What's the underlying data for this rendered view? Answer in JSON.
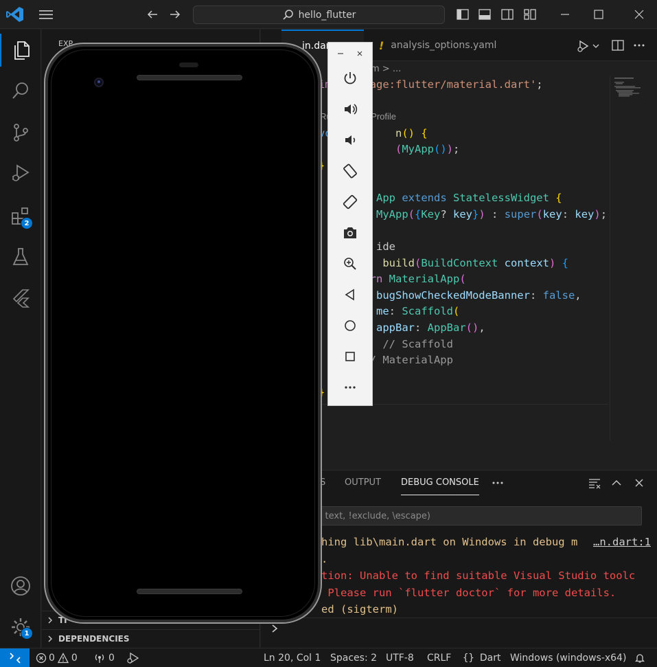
{
  "titlebar": {
    "search_text": "hello_flutter"
  },
  "activity": {
    "extensions_badge": "2",
    "settings_badge": "1"
  },
  "sidebar": {
    "sections": [
      "EXPLORER",
      "TIMELINE",
      "DEPENDENCIES"
    ],
    "partial_header": "EXP",
    "timeline_partial": "TI"
  },
  "editor": {
    "tabs": [
      {
        "label": "main.dart",
        "visible_text": "in.dar",
        "active": true
      },
      {
        "label": "analysis_options.yaml",
        "active": false
      }
    ],
    "breadcrumb": "m  >  ...",
    "codelens": "Ru           g | Profile",
    "lines": [
      {
        "segs": [
          [
            "im",
            "#c586c0"
          ],
          [
            " 'package:flutter/material.dart'",
            "#ce9178"
          ],
          [
            ";",
            "#cccccc"
          ]
        ]
      },
      {
        "segs": []
      },
      {
        "lens": "Ru           g | Profile"
      },
      {
        "segs": [
          [
            "vo",
            "#569cd6"
          ],
          [
            "          ",
            "#ccc"
          ],
          [
            "n",
            "#dcdcaa"
          ],
          [
            "() {",
            "#ffd700"
          ]
        ]
      },
      {
        "segs": [
          [
            "            ",
            "#ccc"
          ],
          [
            "(",
            "#da70d6"
          ],
          [
            "MyApp",
            "#4ec9b0"
          ],
          [
            "()",
            "#179fff"
          ],
          [
            ")",
            "#da70d6"
          ],
          [
            ";",
            "#cccccc"
          ]
        ]
      },
      {
        "segs": [
          [
            "}",
            "#ffd700"
          ]
        ]
      },
      {
        "segs": []
      },
      {
        "segs": [
          [
            "         App ",
            "#4ec9b0"
          ],
          [
            "extends ",
            "#569cd6"
          ],
          [
            "StatelessWidget ",
            "#4ec9b0"
          ],
          [
            "{",
            "#ffd700"
          ]
        ]
      },
      {
        "segs": [
          [
            "         MyApp",
            "#4ec9b0"
          ],
          [
            "(",
            "#da70d6"
          ],
          [
            "{",
            "#179fff"
          ],
          [
            "Key",
            "#4ec9b0"
          ],
          [
            "? ",
            "#cccccc"
          ],
          [
            "key",
            "#9cdcfe"
          ],
          [
            "}",
            "#179fff"
          ],
          [
            ")",
            "#da70d6"
          ],
          [
            " : ",
            "#cccccc"
          ],
          [
            "super",
            "#569cd6"
          ],
          [
            "(",
            "#da70d6"
          ],
          [
            "key",
            "#9cdcfe"
          ],
          [
            ": ",
            "#cccccc"
          ],
          [
            "key",
            "#9cdcfe"
          ],
          [
            ")",
            "#da70d6"
          ],
          [
            ";",
            "#cccccc"
          ]
        ]
      },
      {
        "segs": []
      },
      {
        "segs": [
          [
            "         ide",
            "#cccccc"
          ]
        ]
      },
      {
        "segs": [
          [
            "          ",
            "#ccc"
          ],
          [
            "build",
            "#dcdcaa"
          ],
          [
            "(",
            "#da70d6"
          ],
          [
            "BuildContext ",
            "#4ec9b0"
          ],
          [
            "context",
            "#9cdcfe"
          ],
          [
            ") ",
            "#da70d6"
          ],
          [
            "{",
            "#179fff"
          ]
        ]
      },
      {
        "segs": [
          [
            "        rn ",
            "#c586c0"
          ],
          [
            "MaterialApp",
            "#4ec9b0"
          ],
          [
            "(",
            "#da70d6"
          ]
        ]
      },
      {
        "segs": [
          [
            "         bugShowCheckedModeBanner",
            "#9cdcfe"
          ],
          [
            ": ",
            "#cccccc"
          ],
          [
            "false",
            "#569cd6"
          ],
          [
            ",",
            "#cccccc"
          ]
        ]
      },
      {
        "segs": [
          [
            "         me",
            "#9cdcfe"
          ],
          [
            ": ",
            "#cccccc"
          ],
          [
            "Scaffold",
            "#4ec9b0"
          ],
          [
            "(",
            "#ffd700"
          ]
        ]
      },
      {
        "segs": [
          [
            "         appBar",
            "#9cdcfe"
          ],
          [
            ": ",
            "#cccccc"
          ],
          [
            "AppBar",
            "#4ec9b0"
          ],
          [
            "()",
            "#da70d6"
          ],
          [
            ",",
            "#cccccc"
          ]
        ]
      },
      {
        "segs": [
          [
            "          // Scaffold",
            "#999999"
          ]
        ]
      },
      {
        "segs": [
          [
            "        / MaterialApp",
            "#999999"
          ]
        ]
      },
      {
        "segs": []
      },
      {
        "segs": [
          [
            "}",
            "#ffd700"
          ]
        ]
      }
    ]
  },
  "panel": {
    "tabs": [
      "S",
      "OUTPUT",
      "DEBUG CONSOLE"
    ],
    "active_tab": "DEBUG CONSOLE",
    "filter_placeholder": "g. text, !exclude, \\escape)",
    "lines": [
      {
        "text": "hing lib\\main.dart on Windows in debug m",
        "color": "#e2c08d",
        "link": "…n.dart:1"
      },
      {
        "text": ".",
        "color": "#e2c08d"
      },
      {
        "text": "tion: Unable to find suitable Visual Studio toolc",
        "color": "#f14c4c"
      },
      {
        "text": " Please run `flutter doctor` for more details.",
        "color": "#f14c4c"
      },
      {
        "text": "ed (sigterm)",
        "color": "#e2c08d"
      }
    ]
  },
  "status": {
    "errors": "0",
    "warnings": "0",
    "ports": "0",
    "position": "Ln 20, Col 1",
    "spaces": "Spaces: 2",
    "encoding": "UTF-8",
    "eol": "CRLF",
    "language": "Dart",
    "device": "Windows (windows-x64)"
  },
  "colors": {
    "accent": "#0078d4",
    "bg": "#1f1f1f",
    "sidebar_bg": "#181818"
  }
}
